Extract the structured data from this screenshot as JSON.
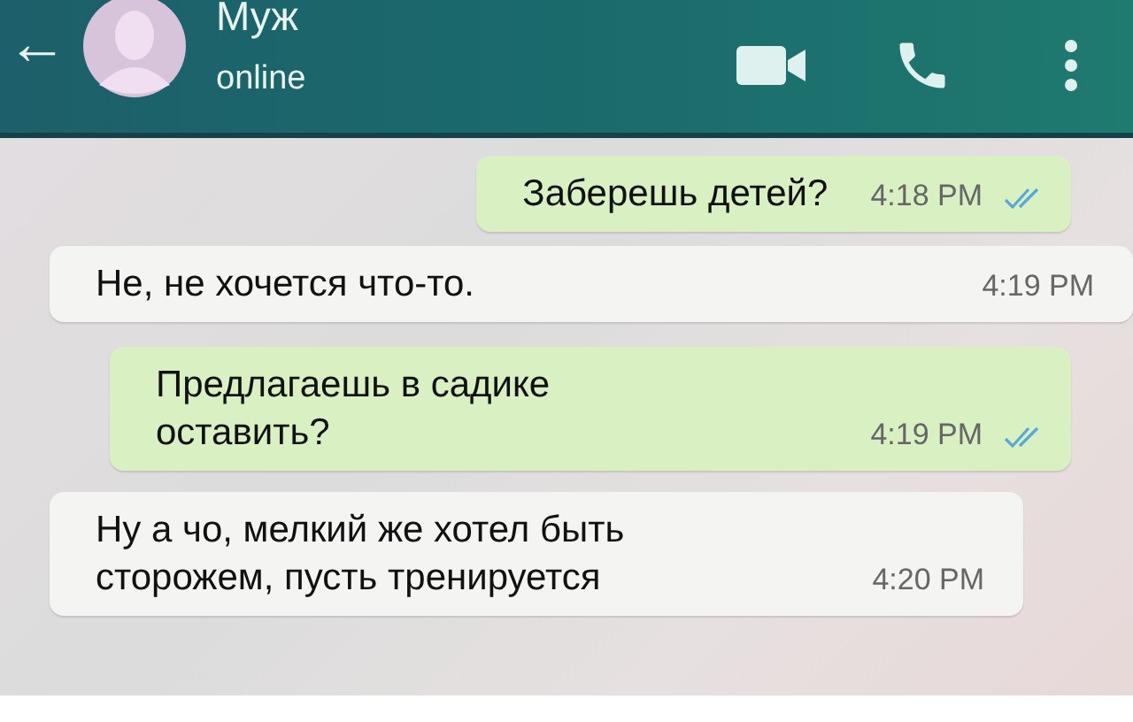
{
  "header": {
    "back": "←",
    "name": "Муж",
    "status": "online"
  },
  "messages": [
    {
      "kind": "outgoing",
      "text": "Заберешь детей?",
      "time": "4:18 PM",
      "read": true
    },
    {
      "kind": "incoming",
      "text": "Не, не хочется что-то.",
      "time": "4:19 PM"
    },
    {
      "kind": "outgoing",
      "text": "Предлагаешь в садике\nоставить?",
      "time": "4:19 PM",
      "read": true
    },
    {
      "kind": "incoming",
      "text": "Ну а чо, мелкий же хотел быть\nсторожем, пусть тренируется",
      "time": "4:20 PM"
    }
  ]
}
